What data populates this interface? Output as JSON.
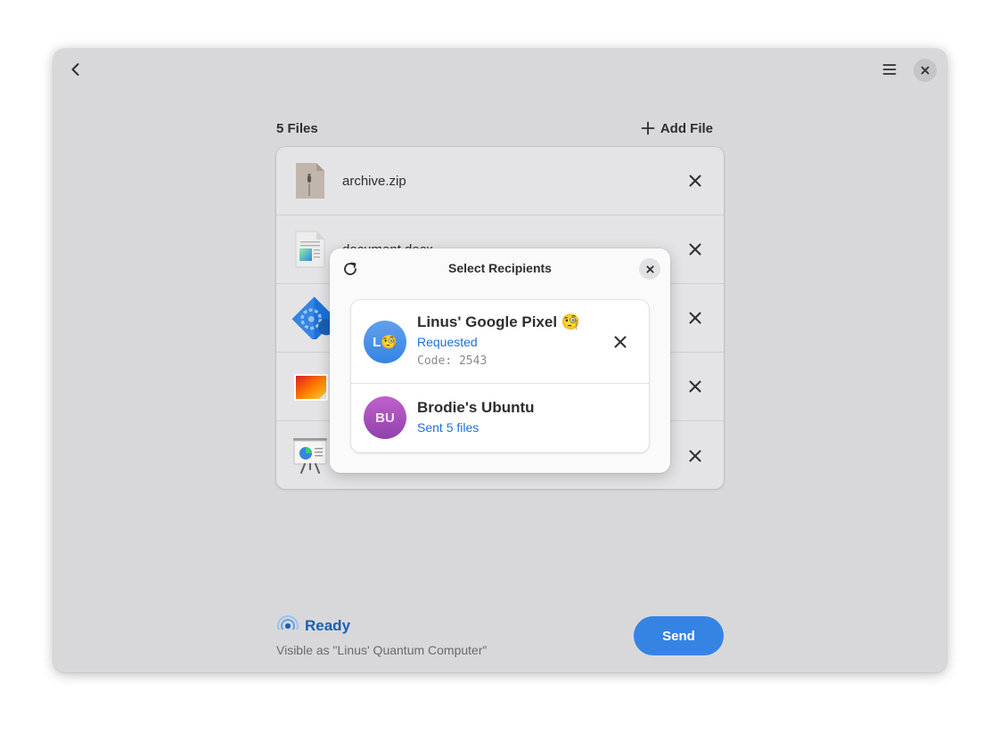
{
  "header": {
    "back_icon": "chevron-left-icon",
    "menu_icon": "hamburger-menu-icon",
    "close_icon": "close-icon"
  },
  "files": {
    "count_label": "5 Files",
    "add_label": "Add File",
    "items": [
      {
        "name": "archive.zip",
        "icon": "zip-archive-icon"
      },
      {
        "name": "document.docx",
        "icon": "document-icon"
      },
      {
        "name": "",
        "icon": "application-icon"
      },
      {
        "name": "",
        "icon": "image-icon"
      },
      {
        "name": "",
        "icon": "presentation-icon"
      }
    ]
  },
  "dialog": {
    "title": "Select Recipients",
    "refresh_icon": "refresh-icon",
    "recipients": [
      {
        "initials": "L🧐",
        "name": "Linus' Google Pixel 🧐",
        "status": "Requested",
        "code": "Code: 2543",
        "color": "#3584e4"
      },
      {
        "initials": "BU",
        "name": "Brodie's Ubuntu",
        "status": "Sent 5 files",
        "color": "#9141ac"
      }
    ]
  },
  "footer": {
    "status_title": "Ready",
    "visible_as": "Visible as \"Linus' Quantum Computer\"",
    "send_label": "Send",
    "accent": "#3584e4"
  }
}
